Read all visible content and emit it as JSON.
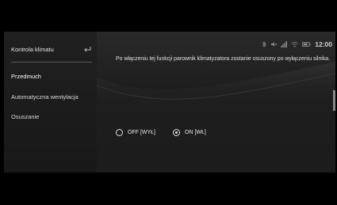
{
  "sidebar": {
    "title": "Kontrola klimatu",
    "items": [
      {
        "label": "Przedmuch"
      },
      {
        "label": "Automatyczna wentylacja"
      },
      {
        "label": "Osuszanie"
      }
    ]
  },
  "status_bar": {
    "time": "12:00",
    "icons": [
      "bluetooth-icon",
      "mute-icon",
      "signal-icon",
      "wifi-icon",
      "battery-icon"
    ]
  },
  "main": {
    "description": "Po włączeniu tej funkcji parownik klimatyzatora zostanie osuszony po wyłączeniu silnika.",
    "options": [
      {
        "label": "OFF [WYŁ]",
        "selected": false
      },
      {
        "label": "ON [WŁ]",
        "selected": true
      }
    ]
  },
  "colors": {
    "background": "#1e1e1e",
    "sidebar": "#1a1a1a",
    "text": "#e2e2e2"
  }
}
